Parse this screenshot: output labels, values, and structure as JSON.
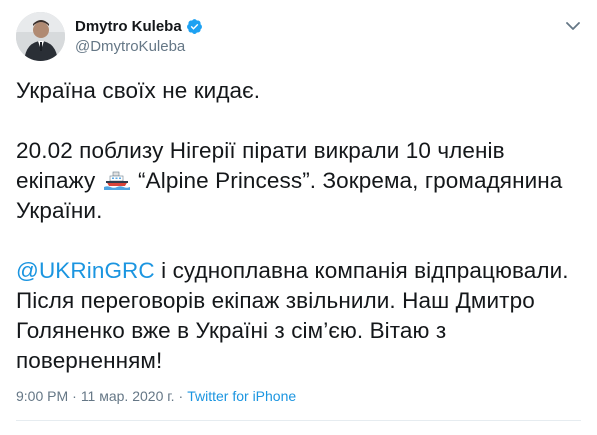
{
  "author": {
    "display_name": "Dmytro Kuleba",
    "handle": "@DmytroKuleba",
    "verified": true,
    "verified_icon": "verified-badge-icon",
    "avatar_icon": "avatar"
  },
  "menu_icon": "chevron-down-icon",
  "tweet": {
    "line1": "Україна своїх не кидає.",
    "para2_before": "20.02 поблизу Нігерії пірати викрали 10 членів екіпажу",
    "ship_icon": "ship-emoji-icon",
    "para2_after": "“Alpine Princess”. Зокрема, громадянина України.",
    "mention": "@UKRinGRC",
    "para3_after": " і судноплавна компанія відпрацювали. Після переговорів екіпаж звільнили. Наш Дмитро Голяненко вже в Україні з сім’єю. Вітаю з поверненням!"
  },
  "meta": {
    "time": "9:00 PM",
    "separator": "·",
    "date": "11 мар. 2020 г.",
    "source": "Twitter for iPhone"
  },
  "colors": {
    "link": "#1b95e0",
    "secondary": "#657786",
    "text": "#14171a"
  }
}
